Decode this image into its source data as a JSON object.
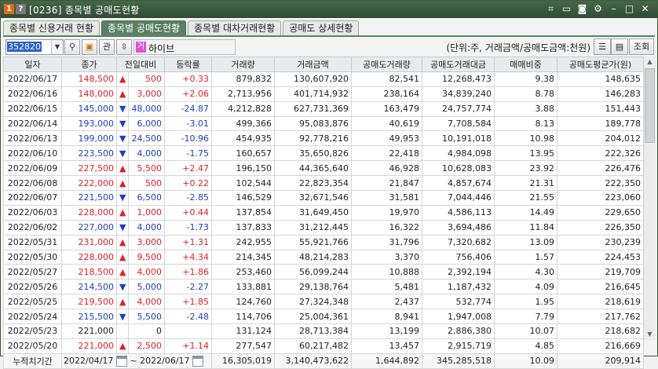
{
  "titlebar": {
    "badge1": "1",
    "badge2": "?",
    "title": "[0236] 종목별 공매도현황",
    "icons": [
      "link-icon",
      "window-icon",
      "camera-icon",
      "gear-icon",
      "minimize-icon",
      "maximize-icon",
      "close-icon"
    ]
  },
  "tabs": [
    {
      "label": "종목별 신용거래 현황",
      "active": false
    },
    {
      "label": "종목별 공매도현황",
      "active": true
    },
    {
      "label": "종목별 대차거래현황",
      "active": false
    },
    {
      "label": "공매도 상세현황",
      "active": false
    }
  ],
  "toolbar": {
    "code": "352820",
    "relation_label": "관",
    "stock_icon_label": "거",
    "stock_name": "하이브",
    "unit_text": "(단위:주, 거래금액/공매도금액:천원)",
    "query_label": "조회"
  },
  "table": {
    "headers": [
      "일자",
      "종가",
      "전일대비",
      "등락률",
      "거래량",
      "거래금액",
      "공매도거래량",
      "공매도거래대금",
      "매매비중",
      "공매도평균가(원)"
    ],
    "rows": [
      {
        "date": "2022/06/17",
        "close": "148,500",
        "dir": "up",
        "change": "500",
        "rate": "+0.33",
        "volume": "879,832",
        "amount": "130,607,920",
        "short_vol": "82,541",
        "short_amt": "12,268,473",
        "ratio": "9.38",
        "short_avg": "148,635"
      },
      {
        "date": "2022/06/16",
        "close": "148,000",
        "dir": "up",
        "change": "3,000",
        "rate": "+2.06",
        "volume": "2,713,956",
        "amount": "401,714,932",
        "short_vol": "238,164",
        "short_amt": "34,839,240",
        "ratio": "8.78",
        "short_avg": "146,283"
      },
      {
        "date": "2022/06/15",
        "close": "145,000",
        "dir": "down",
        "change": "48,000",
        "rate": "-24.87",
        "volume": "4,212,828",
        "amount": "627,731,369",
        "short_vol": "163,479",
        "short_amt": "24,757,774",
        "ratio": "3.88",
        "short_avg": "151,443"
      },
      {
        "date": "2022/06/14",
        "close": "193,000",
        "dir": "down",
        "change": "6,000",
        "rate": "-3.01",
        "volume": "499,366",
        "amount": "95,083,876",
        "short_vol": "40,619",
        "short_amt": "7,708,584",
        "ratio": "8.13",
        "short_avg": "189,778"
      },
      {
        "date": "2022/06/13",
        "close": "199,000",
        "dir": "down",
        "change": "24,500",
        "rate": "-10.96",
        "volume": "454,935",
        "amount": "92,778,216",
        "short_vol": "49,953",
        "short_amt": "10,191,018",
        "ratio": "10.98",
        "short_avg": "204,012"
      },
      {
        "date": "2022/06/10",
        "close": "223,500",
        "dir": "down",
        "change": "4,000",
        "rate": "-1.75",
        "volume": "160,657",
        "amount": "35,650,826",
        "short_vol": "22,418",
        "short_amt": "4,984,098",
        "ratio": "13.95",
        "short_avg": "222,326"
      },
      {
        "date": "2022/06/09",
        "close": "227,500",
        "dir": "up",
        "change": "5,500",
        "rate": "+2.47",
        "volume": "196,150",
        "amount": "44,365,640",
        "short_vol": "46,928",
        "short_amt": "10,628,083",
        "ratio": "23.92",
        "short_avg": "226,476"
      },
      {
        "date": "2022/06/08",
        "close": "222,000",
        "dir": "up",
        "change": "500",
        "rate": "+0.22",
        "volume": "102,544",
        "amount": "22,823,354",
        "short_vol": "21,847",
        "short_amt": "4,857,674",
        "ratio": "21.31",
        "short_avg": "222,350"
      },
      {
        "date": "2022/06/07",
        "close": "221,500",
        "dir": "down",
        "change": "6,500",
        "rate": "-2.85",
        "volume": "146,529",
        "amount": "32,671,546",
        "short_vol": "31,581",
        "short_amt": "7,044,446",
        "ratio": "21.55",
        "short_avg": "223,060"
      },
      {
        "date": "2022/06/03",
        "close": "228,000",
        "dir": "up",
        "change": "1,000",
        "rate": "+0.44",
        "volume": "137,854",
        "amount": "31,649,450",
        "short_vol": "19,970",
        "short_amt": "4,586,113",
        "ratio": "14.49",
        "short_avg": "229,650"
      },
      {
        "date": "2022/06/02",
        "close": "227,000",
        "dir": "down",
        "change": "4,000",
        "rate": "-1.73",
        "volume": "137,833",
        "amount": "31,212,445",
        "short_vol": "16,322",
        "short_amt": "3,694,486",
        "ratio": "11.84",
        "short_avg": "226,350"
      },
      {
        "date": "2022/05/31",
        "close": "231,000",
        "dir": "up",
        "change": "3,000",
        "rate": "+1.31",
        "volume": "242,955",
        "amount": "55,921,766",
        "short_vol": "31,796",
        "short_amt": "7,320,682",
        "ratio": "13.09",
        "short_avg": "230,239"
      },
      {
        "date": "2022/05/30",
        "close": "228,000",
        "dir": "up",
        "change": "9,500",
        "rate": "+4.34",
        "volume": "214,345",
        "amount": "48,214,283",
        "short_vol": "3,370",
        "short_amt": "756,406",
        "ratio": "1.57",
        "short_avg": "224,453"
      },
      {
        "date": "2022/05/27",
        "close": "218,500",
        "dir": "up",
        "change": "4,000",
        "rate": "+1.86",
        "volume": "253,460",
        "amount": "56,099,244",
        "short_vol": "10,888",
        "short_amt": "2,392,194",
        "ratio": "4.30",
        "short_avg": "219,709"
      },
      {
        "date": "2022/05/26",
        "close": "214,500",
        "dir": "down",
        "change": "5,000",
        "rate": "-2.27",
        "volume": "133,881",
        "amount": "29,138,764",
        "short_vol": "5,481",
        "short_amt": "1,187,432",
        "ratio": "4.09",
        "short_avg": "216,645"
      },
      {
        "date": "2022/05/25",
        "close": "219,500",
        "dir": "up",
        "change": "4,000",
        "rate": "+1.85",
        "volume": "124,760",
        "amount": "27,324,348",
        "short_vol": "2,437",
        "short_amt": "532,774",
        "ratio": "1.95",
        "short_avg": "218,619"
      },
      {
        "date": "2022/05/24",
        "close": "215,500",
        "dir": "down",
        "change": "5,500",
        "rate": "-2.48",
        "volume": "114,706",
        "amount": "25,004,361",
        "short_vol": "8,941",
        "short_amt": "1,947,008",
        "ratio": "7.79",
        "short_avg": "217,762"
      },
      {
        "date": "2022/05/23",
        "close": "221,000",
        "dir": "flat",
        "change": "0",
        "rate": "",
        "volume": "131,124",
        "amount": "28,713,384",
        "short_vol": "13,199",
        "short_amt": "2,886,380",
        "ratio": "10.07",
        "short_avg": "218,682"
      },
      {
        "date": "2022/05/20",
        "close": "221,000",
        "dir": "up",
        "change": "2,500",
        "rate": "+1.14",
        "volume": "277,547",
        "amount": "60,217,482",
        "short_vol": "13,457",
        "short_amt": "2,915,719",
        "ratio": "4.85",
        "short_avg": "216,669"
      }
    ],
    "footer": {
      "label": "누적치기간",
      "from": "2022/04/17",
      "tilde": "~",
      "to": "2022/06/17",
      "volume": "16,305,019",
      "amount": "3,140,473,622",
      "short_vol": "1,644,892",
      "short_amt": "345,285,518",
      "ratio": "10.09",
      "short_avg": "209,914"
    }
  },
  "colors": {
    "up": "#e0202a",
    "down": "#1d3ec6",
    "flat": "#222222",
    "titlebar": "#3d5c41",
    "tab_active": "#5b8064"
  }
}
